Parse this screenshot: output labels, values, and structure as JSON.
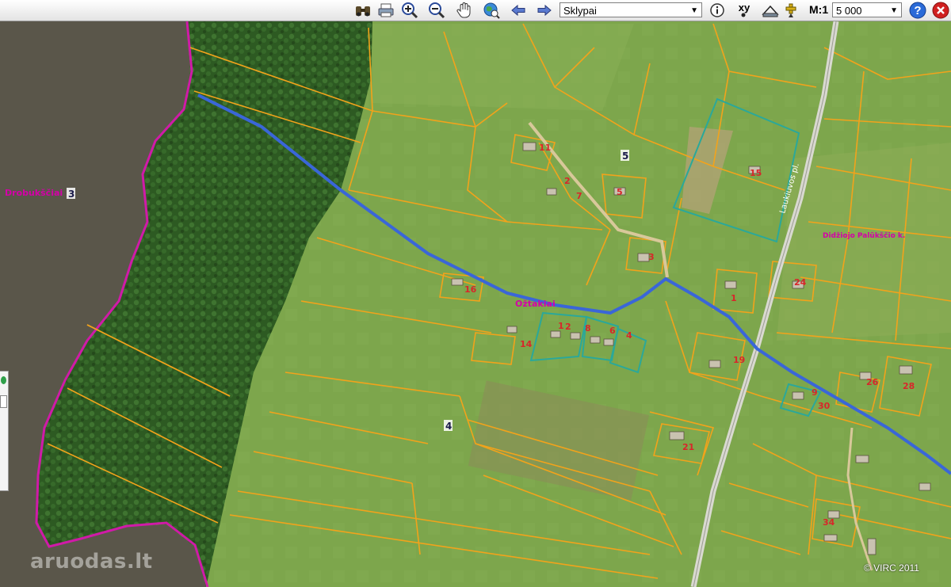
{
  "toolbar": {
    "tools": [
      {
        "name": "binoculars-icon"
      },
      {
        "name": "print-icon"
      },
      {
        "name": "zoom-in-icon"
      },
      {
        "name": "zoom-out-icon"
      },
      {
        "name": "pan-hand-icon"
      },
      {
        "name": "globe-zoom-icon"
      },
      {
        "name": "back-arrow-icon"
      },
      {
        "name": "forward-arrow-icon"
      }
    ],
    "layer_select_value": "Sklypai",
    "info_icon": "info-icon",
    "xy_label": "xy",
    "scale_label": "M:1",
    "scale_value": "5 000",
    "help_label": "?",
    "close_icon": "close-icon"
  },
  "map": {
    "town_labels": [
      "Drobukščiai",
      "Ožtakiai",
      "Didžiojo Palūkščio k."
    ],
    "road_label": "Laukiuvos pl.",
    "block_numbers": [
      "3",
      "5",
      "4"
    ],
    "plot_numbers": [
      "11",
      "2",
      "7",
      "5",
      "3",
      "16",
      "1",
      "2",
      "8",
      "6",
      "4",
      "14",
      "15",
      "24",
      "1",
      "19",
      "26",
      "28",
      "9",
      "30",
      "21",
      "34"
    ],
    "colors": {
      "lake": "#5a564a",
      "forest": "#2f5a22",
      "field": "#7ea64a",
      "plot_boundary": "#f2a31b",
      "road": "#3a66d8",
      "border": "#d01aa8",
      "highlight_plot": "#2aa89a"
    }
  },
  "watermark": "aruodas.lt",
  "copyright": "© VIRC 2011"
}
